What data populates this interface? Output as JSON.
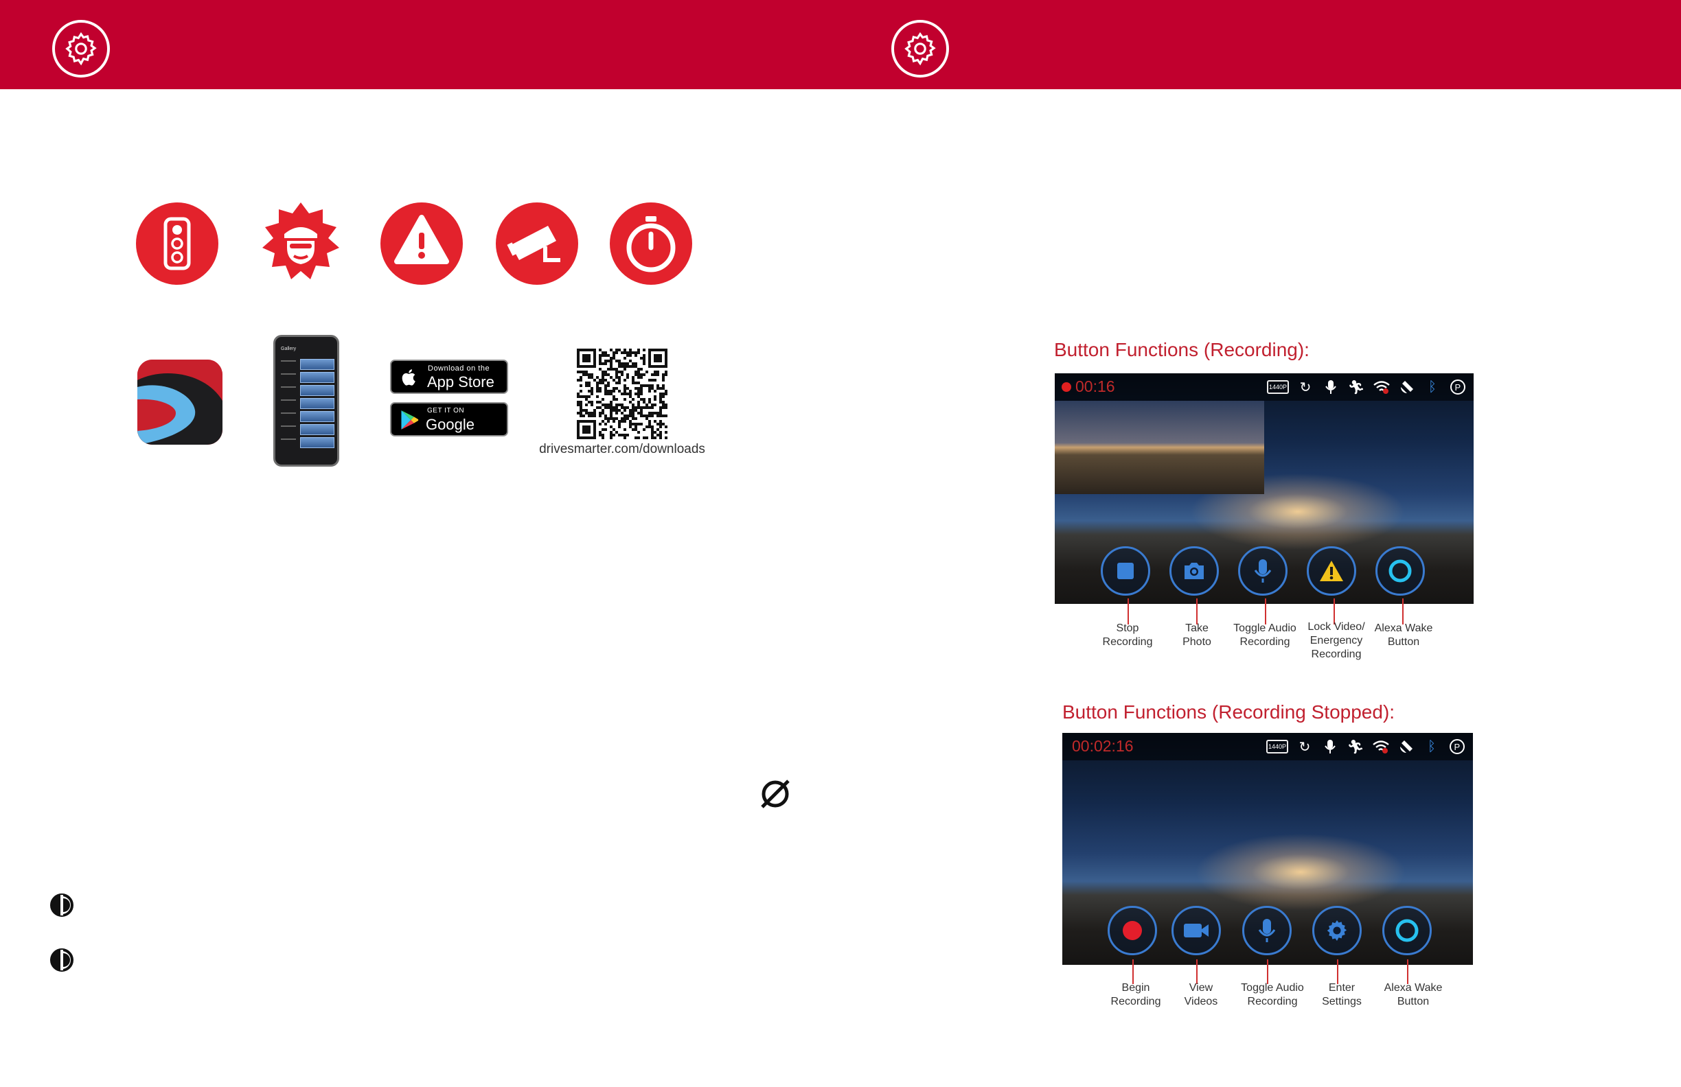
{
  "header": {
    "color": "#c1002e",
    "left_icon": "gear-icon",
    "right_icon": "gear-icon"
  },
  "feature_icons": [
    "traffic-light-icon",
    "police-officer-icon",
    "warning-icon",
    "security-camera-icon",
    "stopwatch-icon"
  ],
  "app_section": {
    "app_store": {
      "small": "Download on the",
      "big": "App Store"
    },
    "google_play": {
      "small": "GET IT ON",
      "big": "Google Play"
    },
    "phone_screen_title": "Gallery",
    "download_url": "drivesmarter.com/downloads"
  },
  "recording": {
    "title": "Button Functions (Recording):",
    "timer": "00:16",
    "resolution_badge": "1440P",
    "buttons": [
      {
        "label_lines": [
          "Stop",
          "Recording"
        ],
        "icon": "stop-square-icon"
      },
      {
        "label_lines": [
          "Take",
          "Photo"
        ],
        "icon": "camera-icon"
      },
      {
        "label_lines": [
          "Toggle Audio",
          "Recording"
        ],
        "icon": "microphone-icon"
      },
      {
        "label_lines": [
          "Lock Video/",
          "Energency",
          "Recording"
        ],
        "icon": "warning-icon"
      },
      {
        "label_lines": [
          "Alexa Wake",
          "Button"
        ],
        "icon": "alexa-ring-icon"
      }
    ]
  },
  "stopped": {
    "title": "Button Functions (Recording Stopped):",
    "timer": "00:02:16",
    "resolution_badge": "1440P",
    "buttons": [
      {
        "label_lines": [
          "Begin",
          "Recording"
        ],
        "icon": "record-dot-icon"
      },
      {
        "label_lines": [
          "View",
          "Videos"
        ],
        "icon": "video-camera-icon"
      },
      {
        "label_lines": [
          "Toggle Audio",
          "Recording"
        ],
        "icon": "microphone-icon"
      },
      {
        "label_lines": [
          "Enter",
          "Settings"
        ],
        "icon": "settings-gear-icon"
      },
      {
        "label_lines": [
          "Alexa Wake",
          "Button"
        ],
        "icon": "alexa-ring-icon"
      }
    ]
  },
  "status_icons": [
    "resolution-badge-icon",
    "loop-3-icon",
    "microphone-icon",
    "motion-detect-icon",
    "wifi-off-icon",
    "satellite-icon",
    "bluetooth-icon",
    "parking-icon"
  ],
  "misc_icons": [
    "empty-set-icon",
    "split-circle-icon",
    "split-circle-icon"
  ],
  "colors": {
    "brand_red": "#c1002e",
    "title_red": "#c1202f",
    "button_ring": "#3a7bd0"
  }
}
